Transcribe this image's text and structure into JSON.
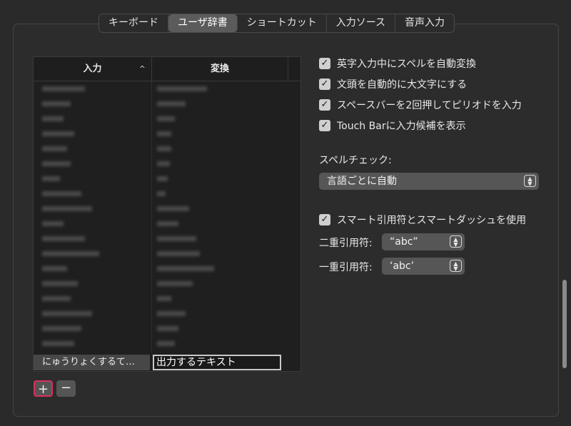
{
  "tabs": [
    {
      "label": "キーボード",
      "active": false
    },
    {
      "label": "ユーザ辞書",
      "active": true
    },
    {
      "label": "ショートカット",
      "active": false
    },
    {
      "label": "入力ソース",
      "active": false
    },
    {
      "label": "音声入力",
      "active": false
    }
  ],
  "table": {
    "col_input": "入力",
    "col_convert": "変換",
    "sort_indicator": "^",
    "edit_reading": "にゅうりょくするて…",
    "edit_output": "出力するテキスト"
  },
  "buttons": {
    "add": "+",
    "remove": "−"
  },
  "options": {
    "auto_correct": "英字入力中にスペルを自動変換",
    "auto_capitalize": "文頭を自動的に大文字にする",
    "double_space_period": "スペースバーを2回押してピリオドを入力",
    "touch_bar": "Touch Barに入力候補を表示",
    "smart_quotes": "スマート引用符とスマートダッシュを使用"
  },
  "spellcheck": {
    "label": "スペルチェック:",
    "value": "言語ごとに自動"
  },
  "quotes": {
    "double_label": "二重引用符:",
    "double_value": "“abc”",
    "single_label": "一重引用符:",
    "single_value": "‘abc’"
  },
  "colors": {
    "accent_focus": "#d9305c",
    "checkbox": "#cfcfcf"
  }
}
